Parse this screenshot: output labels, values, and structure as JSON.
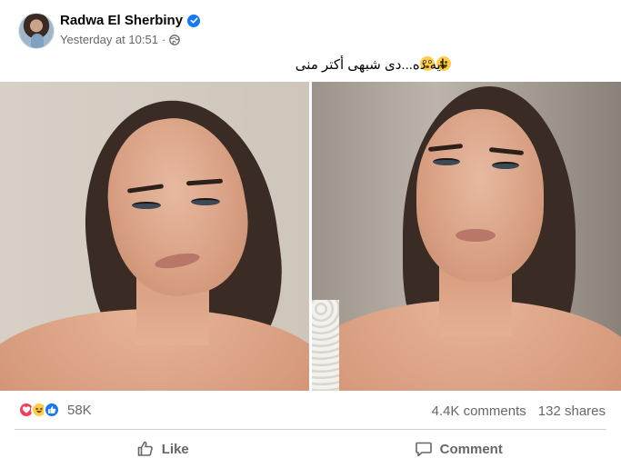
{
  "post": {
    "author": "Radwa El Sherbiny",
    "timestamp": "Yesterday at 10:51",
    "separator": "·",
    "caption": "ايه ده...دى شبهى أكتر منى",
    "caption_emojis": [
      "laughing-emoji",
      "flushed-emoji"
    ]
  },
  "stats": {
    "reaction_types": [
      "love",
      "haha",
      "like"
    ],
    "reaction_count": "58K",
    "comments": "4.4K comments",
    "shares": "132 shares"
  },
  "actions": {
    "like_label": "Like",
    "comment_label": "Comment"
  },
  "colors": {
    "brand_blue": "#1877f2",
    "secondary_text": "#65676b",
    "love_red": "#f33e58",
    "haha_yellow": "#ffcc4d"
  }
}
